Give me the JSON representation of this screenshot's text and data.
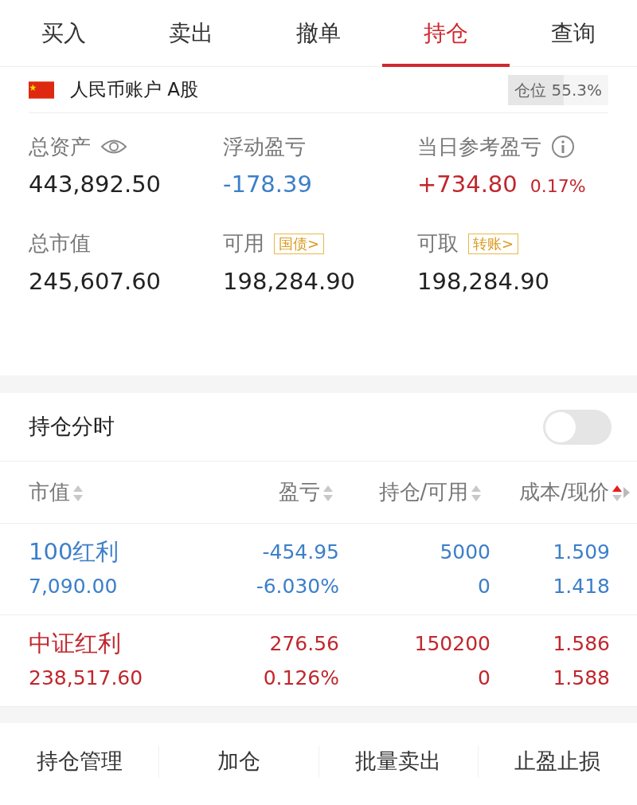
{
  "tabs": [
    {
      "label": "买入",
      "selected": false
    },
    {
      "label": "卖出",
      "selected": false
    },
    {
      "label": "撤单",
      "selected": false
    },
    {
      "label": "持仓",
      "selected": true
    },
    {
      "label": "查询",
      "selected": false
    }
  ],
  "account": {
    "name": "人民币账户 A股",
    "position": {
      "label": "仓位",
      "value": "55.3%",
      "level": 0.553
    }
  },
  "stats": [
    {
      "kind": "eye",
      "label": "总资产",
      "value": "443,892.50",
      "color": "#222222"
    },
    {
      "kind": "plain",
      "label": "浮动盈亏",
      "value": "-178.39",
      "color": "#3c7fc9"
    },
    {
      "kind": "info",
      "label": "当日参考盈亏",
      "value": "+734.80",
      "extra": "0.17%",
      "color": "#c0272d"
    },
    {
      "kind": "plain",
      "label": "总市值",
      "value": "245,607.60",
      "color": "#222222"
    },
    {
      "kind": "tag",
      "label": "可用",
      "tag": "国债>",
      "value": "198,284.90",
      "color": "#222222"
    },
    {
      "kind": "tag",
      "label": "可取",
      "tag": "转账>",
      "value": "198,284.90",
      "color": "#222222"
    }
  ],
  "intraday": {
    "label": "持仓分时",
    "on": false
  },
  "table": {
    "columns": [
      {
        "label": "市值",
        "selected": false
      },
      {
        "label": "盈亏",
        "selected": false
      },
      {
        "label": "持仓/可用",
        "selected": false
      },
      {
        "label": "成本/现价",
        "selected": true
      }
    ],
    "rows": [
      {
        "color": "#3c7fc9",
        "name": "100红利",
        "market_value": "7,090.00",
        "pnl": "-454.95",
        "pnl_pct": "-6.030%",
        "holding": "5000",
        "available": "0",
        "cost": "1.509",
        "price": "1.418"
      },
      {
        "color": "#c0272d",
        "name": "中证红利",
        "market_value": "238,517.60",
        "pnl": "276.56",
        "pnl_pct": "0.126%",
        "holding": "150200",
        "available": "0",
        "cost": "1.586",
        "price": "1.588"
      }
    ]
  },
  "actions": [
    "持仓管理",
    "加仓",
    "批量卖出",
    "止盈止损"
  ]
}
